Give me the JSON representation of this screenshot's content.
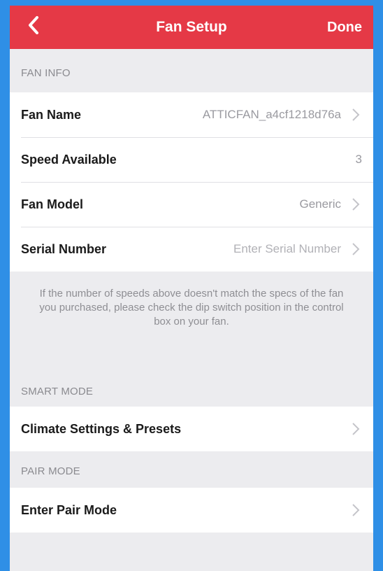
{
  "navbar": {
    "title": "Fan Setup",
    "done_label": "Done",
    "background": "#e53946"
  },
  "fan_info": {
    "header": "FAN INFO",
    "rows": [
      {
        "label": "Fan Name",
        "value": "ATTICFAN_a4cf1218d76a"
      },
      {
        "label": "Speed Available",
        "value": "3"
      },
      {
        "label": "Fan Model",
        "value": "Generic"
      },
      {
        "label": "Serial Number",
        "value": "Enter Serial Number"
      }
    ],
    "note": "If the number of speeds above doesn't match the specs of the fan you purchased, please check the dip switch position in the control box on your fan."
  },
  "smart_mode": {
    "header": "SMART MODE",
    "rows": [
      {
        "label": "Climate Settings & Presets"
      }
    ]
  },
  "pair_mode": {
    "header": "PAIR MODE",
    "rows": [
      {
        "label": "Enter Pair Mode"
      }
    ]
  },
  "icons": {
    "back": "chevron-left-icon",
    "disclosure": "chevron-right-icon"
  }
}
